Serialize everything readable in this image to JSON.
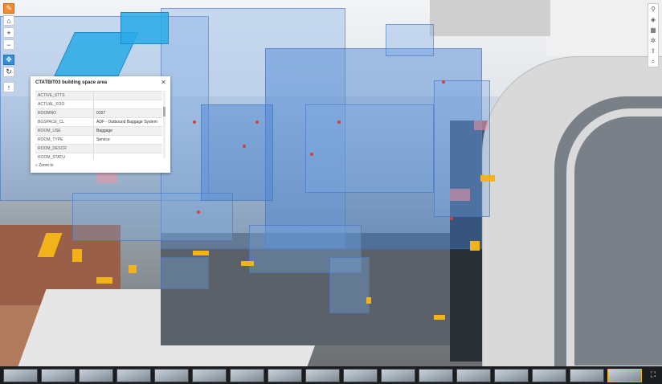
{
  "popup": {
    "title": "CTATBIT03 building space area",
    "close_icon": "close-icon",
    "rows": [
      {
        "key": "ACTIVE_STTS",
        "value": ""
      },
      {
        "key": "ACTUAL_FOO",
        "value": ""
      },
      {
        "key": "ROOMNO",
        "value": "0157"
      },
      {
        "key": "BGSPACE_CL",
        "value": "ADF - Outbound Baggage System"
      },
      {
        "key": "ROOM_USE",
        "value": "Baggage"
      },
      {
        "key": "ROOM_TYPE",
        "value": "Service"
      },
      {
        "key": "ROOM_DESCR",
        "value": ""
      },
      {
        "key": "ROOM_STATU",
        "value": ""
      }
    ],
    "footer_label": "Zoom to"
  },
  "left_toolbar": [
    {
      "name": "pencil-icon",
      "glyph": "✎"
    },
    {
      "name": "home-icon",
      "glyph": "⌂"
    },
    {
      "name": "zoom-in-icon",
      "glyph": "+"
    },
    {
      "name": "zoom-out-icon",
      "glyph": "−"
    },
    {
      "name": "pan-icon",
      "glyph": "✥"
    },
    {
      "name": "rotate-icon",
      "glyph": "↻"
    },
    {
      "name": "compass-icon",
      "glyph": "↑"
    }
  ],
  "right_toolbar": [
    {
      "name": "search-icon",
      "glyph": "⚲"
    },
    {
      "name": "layers-icon",
      "glyph": "◈"
    },
    {
      "name": "basemap-icon",
      "glyph": "▦"
    },
    {
      "name": "settings-icon",
      "glyph": "✲"
    },
    {
      "name": "share-icon",
      "glyph": "⇪"
    },
    {
      "name": "measure-icon",
      "glyph": "⌕"
    }
  ],
  "filmstrip": {
    "thumb_count": 17,
    "selected_index": 16,
    "fullscreen_icon": "fullscreen-icon"
  },
  "colors": {
    "accent_orange": "#f28a30",
    "active_blue": "#2f8fd8",
    "highlight_cyan": "#28aae6",
    "marker_yellow": "#f2b21a"
  }
}
